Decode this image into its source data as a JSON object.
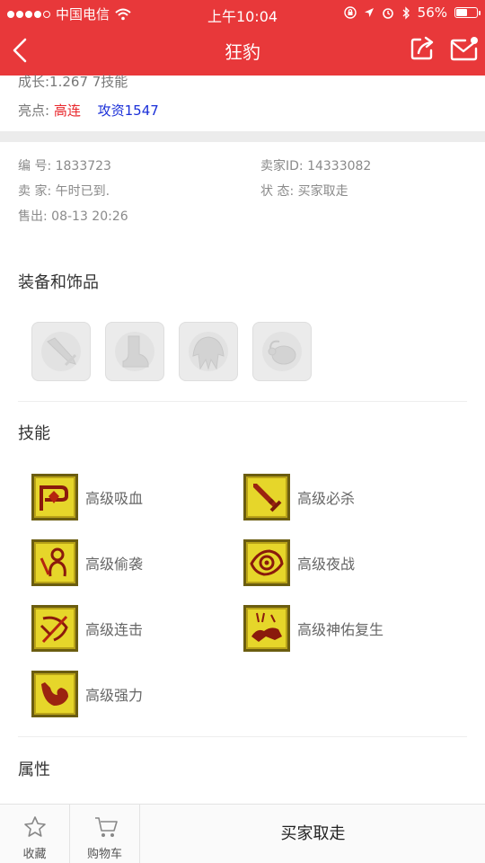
{
  "status_bar": {
    "carrier": "中国电信",
    "time": "上午10:04",
    "battery": "56%",
    "battery_level": 0.56
  },
  "header": {
    "title": "狂豹"
  },
  "summary": {
    "growth_line": "成长:1.267 7技能",
    "highlight_label": "亮点:",
    "highlight_red": "高连",
    "highlight_blue": "攻资1547"
  },
  "info": {
    "id": "编 号: 1833723",
    "seller_id": "卖家ID: 14333082",
    "seller": "卖 家: 午时已到.",
    "state": "状 态: 买家取走",
    "sold": "售出: 08-13 20:26"
  },
  "equipment": {
    "title": "装备和饰品",
    "slots": [
      "weapon-slot-icon",
      "boots-slot-icon",
      "helmet-slot-icon",
      "accessory-slot-icon"
    ]
  },
  "skills": {
    "title": "技能",
    "items": [
      {
        "label": "高级吸血",
        "icon": "vampire-skill-icon"
      },
      {
        "label": "高级必杀",
        "icon": "sword-skill-icon"
      },
      {
        "label": "高级偷袭",
        "icon": "sneak-attack-skill-icon"
      },
      {
        "label": "高级夜战",
        "icon": "eye-skill-icon"
      },
      {
        "label": "高级连击",
        "icon": "combo-skill-icon"
      },
      {
        "label": "高级神佑复生",
        "icon": "revive-skill-icon"
      },
      {
        "label": "高级强力",
        "icon": "strength-skill-icon"
      }
    ]
  },
  "attributes": {
    "title": "属性"
  },
  "bottom_bar": {
    "favorite": "收藏",
    "cart": "购物车",
    "status": "买家取走"
  },
  "colors": {
    "brand_red": "#e8383a",
    "highlight_red": "#e8262b",
    "highlight_blue": "#1a2fd8",
    "skill_icon_bg": "#e6d62a"
  }
}
